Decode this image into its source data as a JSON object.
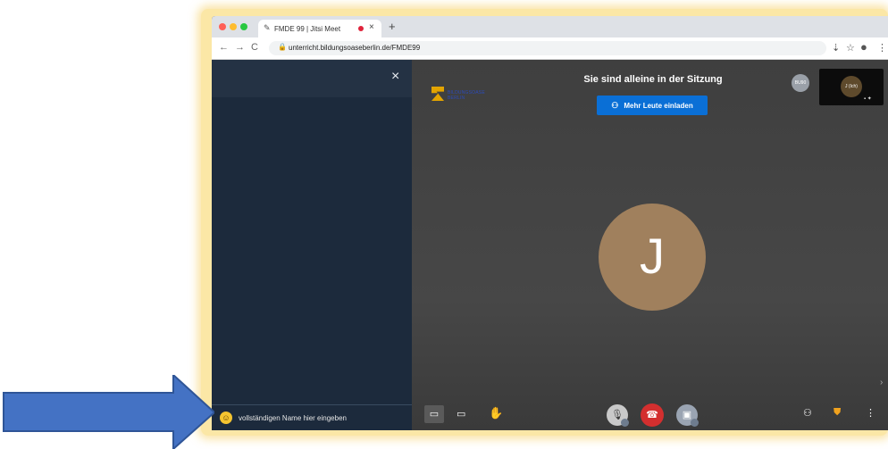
{
  "browser": {
    "tab_title": "FMDE 99 | Jitsi Meet",
    "tab_close": "×",
    "new_tab": "+",
    "url": "unterricht.bildungsoaseberlin.de/FMDE99",
    "nav_back": "←",
    "nav_forward": "→",
    "nav_reload": "C"
  },
  "sidebar": {
    "close": "×",
    "name_placeholder": "vollständigen Name hier eingeben"
  },
  "stage": {
    "title": "Sie sind alleine in der Sitzung",
    "invite_label": "Mehr Leute einladen",
    "logo_text": "BILDUNGSOASE BERLIN",
    "big_avatar_initial": "J",
    "mini_avatar_label": "BU90",
    "thumb_label": "J (Ich)"
  },
  "colors": {
    "accent": "#0a6fd6",
    "hangup": "#d32f2f",
    "avatar": "#a0805d",
    "sidebar": "#1c2a3c",
    "arrow": "#4472c4",
    "frame": "#f6cd5c"
  },
  "icons": [
    "chat-icon",
    "screenshare-icon",
    "raise-hand-icon",
    "microphone-icon",
    "hangup-icon",
    "camera-icon",
    "participants-icon",
    "security-shield-icon",
    "more-icon"
  ]
}
